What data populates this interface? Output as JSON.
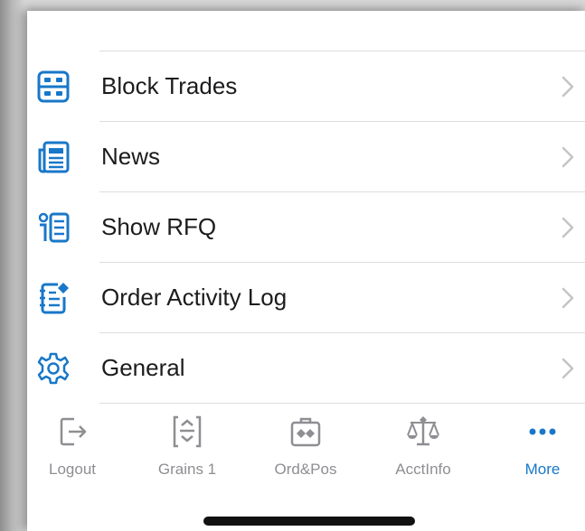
{
  "menu": {
    "items": [
      {
        "label": "Block Trades",
        "icon": "block-trades-icon"
      },
      {
        "label": "News",
        "icon": "news-icon"
      },
      {
        "label": "Show RFQ",
        "icon": "rfq-icon"
      },
      {
        "label": "Order Activity Log",
        "icon": "order-activity-log-icon"
      },
      {
        "label": "General",
        "icon": "gear-icon"
      }
    ]
  },
  "tabbar": {
    "tabs": [
      {
        "label": "Logout",
        "icon": "logout-icon",
        "active": false
      },
      {
        "label": "Grains 1",
        "icon": "grains-icon",
        "active": false
      },
      {
        "label": "Ord&Pos",
        "icon": "ord-pos-icon",
        "active": false
      },
      {
        "label": "AcctInfo",
        "icon": "scales-icon",
        "active": false
      },
      {
        "label": "More",
        "icon": "more-dots-icon",
        "active": true
      }
    ]
  },
  "colors": {
    "accent": "#1877c9",
    "inactive": "#8e8e93",
    "text": "#1c1c1e",
    "divider": "#dedede"
  }
}
